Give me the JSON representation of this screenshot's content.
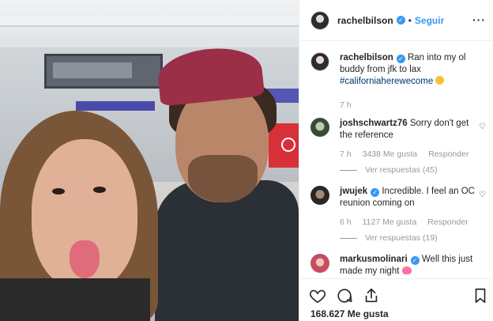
{
  "post": {
    "author": "rachelbilson",
    "follow_label": "Seguir",
    "more_label": "···",
    "caption_text": "Ran into my ol buddy from jfk to lax",
    "caption_hashtag": "#californiaherewecome",
    "caption_time": "7 h",
    "likes": "168.627 Me gusta"
  },
  "comments": [
    {
      "user": "joshschwartz76",
      "verified": false,
      "text": "Sorry don't get the reference",
      "time": "7 h",
      "likes": "3438 Me gusta",
      "reply_label": "Responder",
      "replies": "Ver respuestas (45)"
    },
    {
      "user": "jwujek",
      "verified": true,
      "text": "Incredible. I feel an OC reunion coming on",
      "time": "6 h",
      "likes": "1127 Me gusta",
      "reply_label": "Responder",
      "replies": "Ver respuestas (19)"
    },
    {
      "user": "markusmolinari",
      "verified": true,
      "text": "Well this just made my night"
    }
  ],
  "colors": {
    "link": "#3897f0",
    "hashtag": "#003569",
    "muted": "#999999",
    "verified": "#3897f0"
  },
  "icons": [
    "heart-icon",
    "comment-icon",
    "share-icon",
    "bookmark-icon",
    "more-icon"
  ]
}
